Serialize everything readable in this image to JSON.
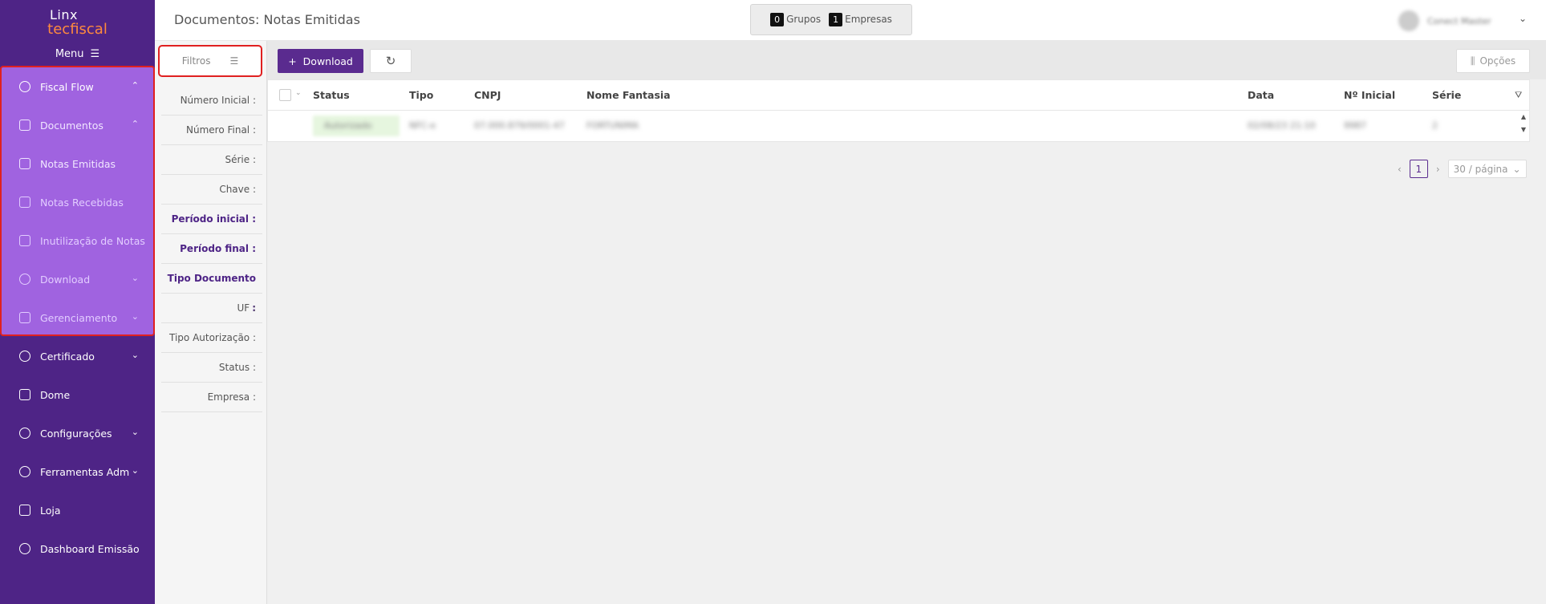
{
  "brand": {
    "line1": "Linx",
    "line2a": "tec",
    "line2b": "fiscal"
  },
  "menu_label": "Menu",
  "nav": [
    {
      "label": "Fiscal Flow",
      "chev": "⌃"
    },
    {
      "label": "Documentos",
      "chev": "⌃"
    },
    {
      "label": "Notas Emitidas"
    },
    {
      "label": "Notas Recebidas"
    },
    {
      "label": "Inutilização de Notas"
    },
    {
      "label": "Download",
      "chev": "⌄"
    },
    {
      "label": "Gerenciamento",
      "chev": "⌄"
    },
    {
      "label": "Certificado",
      "chev": "⌄"
    },
    {
      "label": "Dome"
    },
    {
      "label": "Configurações",
      "chev": "⌄"
    },
    {
      "label": "Ferramentas Adm",
      "chev": "⌄"
    },
    {
      "label": "Loja"
    },
    {
      "label": "Dashboard Emissão"
    }
  ],
  "header": {
    "title": "Documentos: Notas Emitidas",
    "grupos_count": "0",
    "grupos_label": "Grupos",
    "empresas_count": "1",
    "empresas_label": "Empresas",
    "user_name": "Conect Master"
  },
  "filters": {
    "button_label": "Filtros",
    "fields": [
      "Número Inicial :",
      "Número Final :",
      "Série :",
      "Chave :",
      "Período inicial :",
      "Período final :",
      "Tipo Documento :",
      "UF :",
      "Tipo Autorização :",
      "Status :",
      "Empresa :"
    ]
  },
  "toolbar": {
    "download_label": "Download",
    "options_label": "Opções"
  },
  "table": {
    "columns": [
      "Status",
      "Tipo",
      "CNPJ",
      "Nome Fantasia",
      "Data",
      "Nº Inicial",
      "Série"
    ],
    "rows": [
      {
        "status": "Autorizado",
        "tipo": "NFC-e",
        "cnpj": "07.000.879/0001-47",
        "nome": "FORTUNIMA",
        "data": "02/08/23 21:10",
        "inicial": "9987",
        "serie": "2"
      }
    ]
  },
  "pagination": {
    "current": "1",
    "page_size": "30 / página"
  },
  "colors": {
    "sidebar": "#4e2486",
    "accent": "#5a2b8f",
    "highlight": "#a063e0",
    "annotation": "#e02020"
  }
}
